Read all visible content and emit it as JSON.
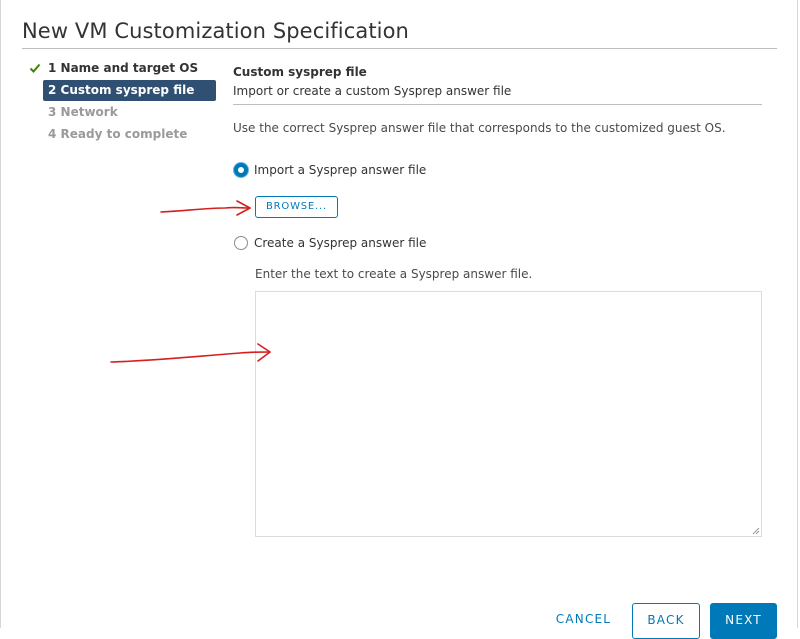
{
  "dialog": {
    "title": "New VM Customization Specification"
  },
  "steps": [
    {
      "label": "1 Name and target OS",
      "state": "done"
    },
    {
      "label": "2 Custom sysprep file",
      "state": "active"
    },
    {
      "label": "3 Network",
      "state": "pending"
    },
    {
      "label": "4 Ready to complete",
      "state": "pending"
    }
  ],
  "main": {
    "section_title": "Custom sysprep file",
    "section_subtitle": "Import or create a custom Sysprep answer file",
    "instructions": "Use the correct Sysprep answer file that corresponds to the customized guest OS.",
    "import_option": {
      "label": "Import a Sysprep answer file",
      "checked": true
    },
    "browse_label": "BROWSE...",
    "create_option": {
      "label": "Create a Sysprep answer file",
      "checked": false
    },
    "create_hint": "Enter the text to create a Sysprep answer file.",
    "answer_text": ""
  },
  "footer": {
    "cancel_label": "CANCEL",
    "back_label": "BACK",
    "next_label": "NEXT"
  },
  "colors": {
    "accent": "#0079b8",
    "active_step": "#2f5072",
    "check": "#3c8500",
    "annotation": "#d42020"
  }
}
